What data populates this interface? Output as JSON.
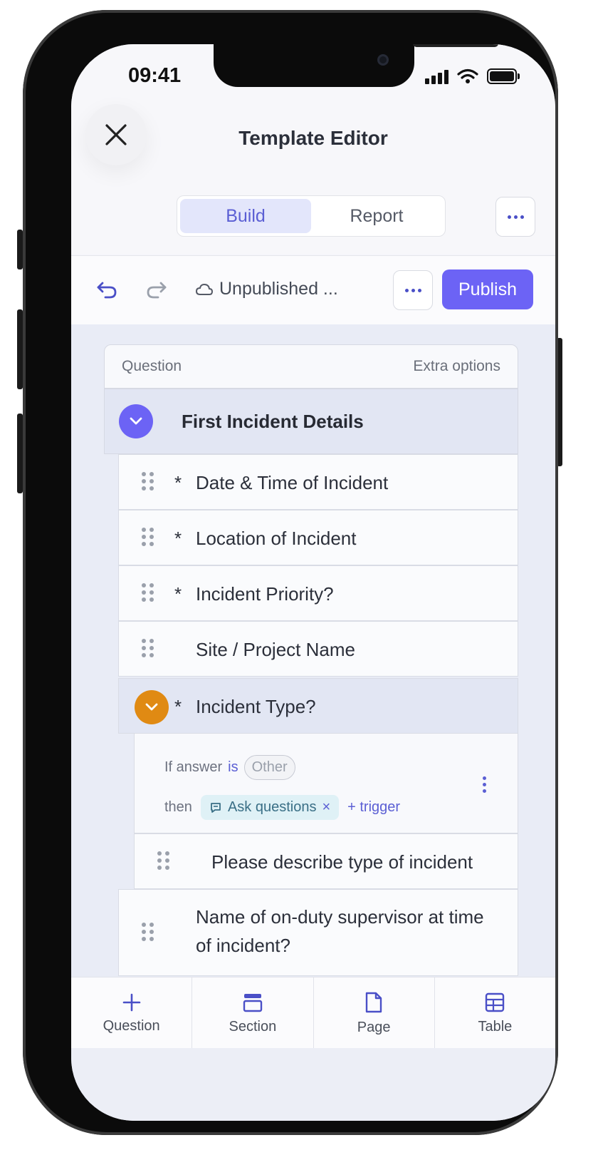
{
  "status": {
    "time": "09:41"
  },
  "header": {
    "title": "Template Editor",
    "tabs": [
      {
        "label": "Build",
        "active": true
      },
      {
        "label": "Report",
        "active": false
      }
    ]
  },
  "toolbar": {
    "status_text": "Unpublished ...",
    "publish_label": "Publish"
  },
  "card": {
    "column_question": "Question",
    "column_extra": "Extra options",
    "section_title": "First Incident Details",
    "rows": [
      {
        "required": "*",
        "label": "Date & Time of Incident"
      },
      {
        "required": "*",
        "label": "Location of Incident"
      },
      {
        "required": "*",
        "label": "Incident Priority?"
      },
      {
        "required": "",
        "label": "Site / Project Name"
      },
      {
        "required": "*",
        "label": "Incident Type?"
      }
    ],
    "logic": {
      "if_text": "If answer",
      "operator": "is",
      "value": "Other",
      "then_text": "then",
      "action": "Ask questions",
      "action_remove": "×",
      "add_trigger": "+ trigger"
    },
    "sub_row": {
      "label": "Please describe type of incident"
    },
    "last_row": {
      "label": "Name of on-duty supervisor at time of incident?"
    }
  },
  "bottom_nav": [
    {
      "label": "Question",
      "icon": "plus-icon"
    },
    {
      "label": "Section",
      "icon": "section-icon"
    },
    {
      "label": "Page",
      "icon": "page-icon"
    },
    {
      "label": "Table",
      "icon": "table-icon"
    }
  ],
  "colors": {
    "accent": "#6c63f5",
    "logic_chevron": "#e08a13"
  }
}
